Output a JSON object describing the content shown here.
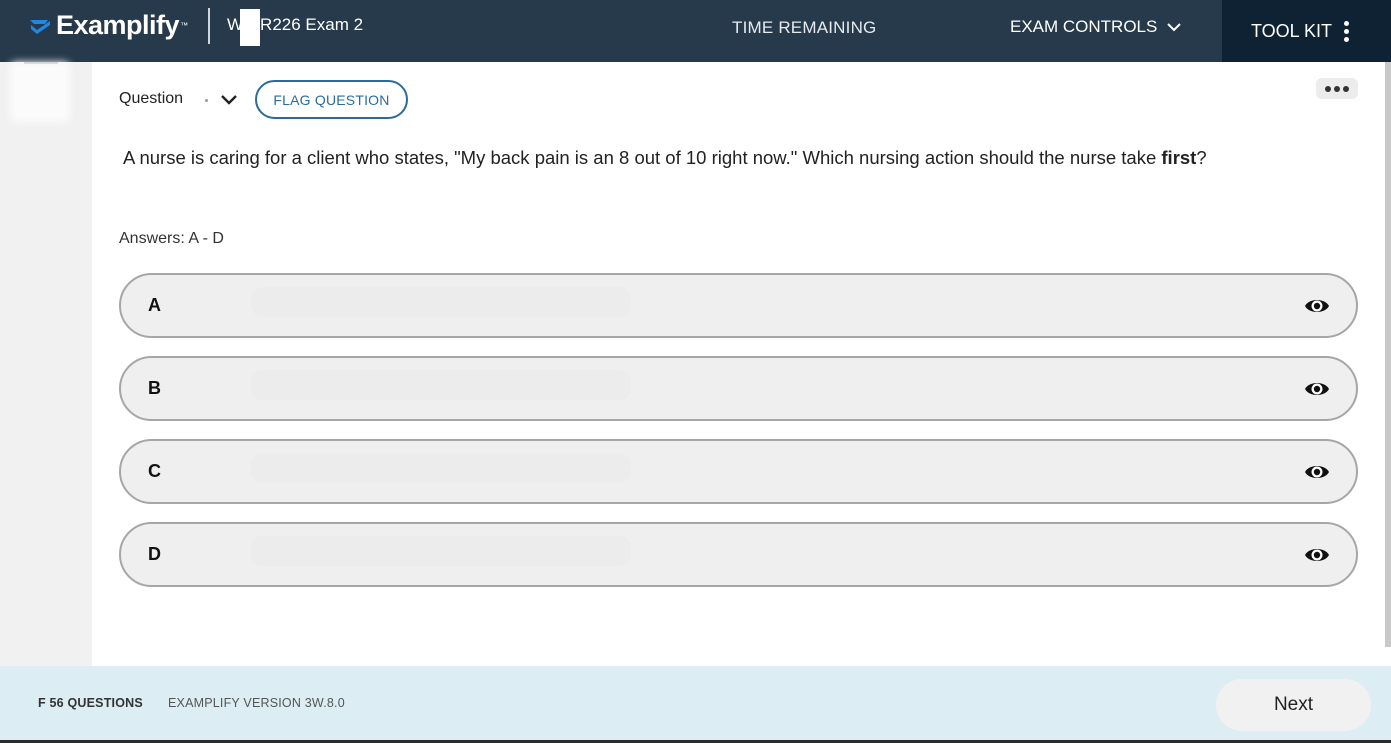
{
  "header": {
    "logo_text": "Examplify",
    "logo_tm": "™",
    "exam_title": "W NR226 Exam 2",
    "exam_title_faint": "",
    "time_remaining_label": "TIME REMAINING",
    "time_remaining_value": "",
    "exam_controls_label": "EXAM CONTROLS",
    "tool_kit_label": "TOOL KIT",
    "colors": {
      "bar": "#263a4b",
      "toolkit": "#0f2233"
    }
  },
  "question": {
    "label": "Question",
    "flag_label": "FLAG QUESTION",
    "stem_before": "A nurse is caring for a client who states, \"My back pain is an 8 out of 10 right now.\"  Which nursing action should the nurse take ",
    "stem_bold": "first",
    "stem_after": "?"
  },
  "answers": {
    "label": "Answers: A - D",
    "options": [
      {
        "letter": "A",
        "icon": "eye-icon"
      },
      {
        "letter": "B",
        "icon": "eye-icon"
      },
      {
        "letter": "C",
        "icon": "eye-icon"
      },
      {
        "letter": "D",
        "icon": "eye-icon"
      }
    ]
  },
  "footer": {
    "question_count": "F 56 QUESTIONS",
    "version": "EXAMPLIFY VERSION 3W.8.0",
    "next_label": "Next"
  },
  "accent_color": "#2a6b9e"
}
